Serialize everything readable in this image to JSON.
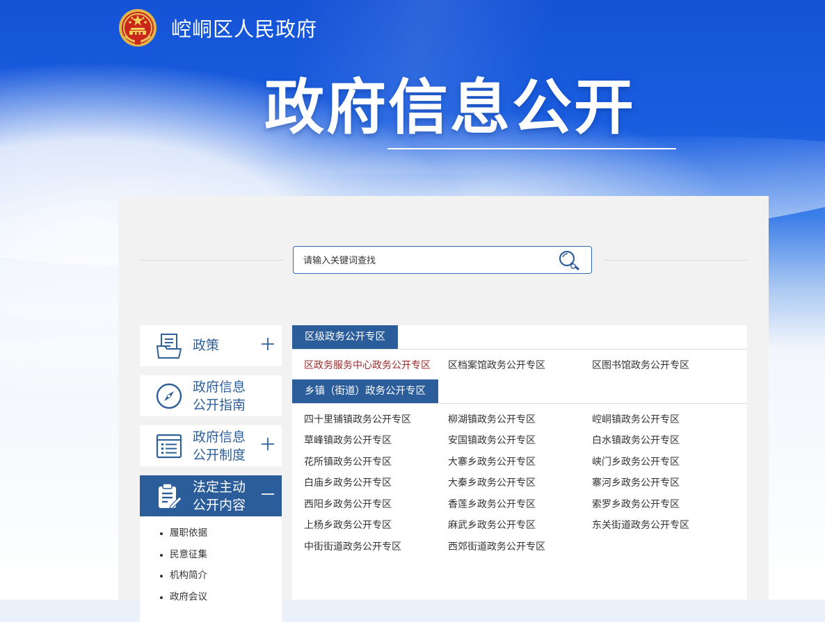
{
  "header": {
    "site_title": "崆峒区人民政府",
    "main_title": "政府信息公开",
    "emblem_icon": "national-emblem-icon"
  },
  "search": {
    "placeholder": "请输入关键词查找",
    "icon": "search-icon"
  },
  "sidebar": {
    "items": [
      {
        "label": "政策",
        "icon": "document-icon",
        "toggle": "plus"
      },
      {
        "label": "政府信息\n公开指南",
        "icon": "compass-icon",
        "toggle": "none"
      },
      {
        "label": "政府信息\n公开制度",
        "icon": "list-icon",
        "toggle": "plus"
      },
      {
        "label": "法定主动\n公开内容",
        "icon": "clipboard-edit-icon",
        "toggle": "minus",
        "active": true
      }
    ],
    "sub_items": [
      "履职依据",
      "民意征集",
      "机构简介",
      "政府会议"
    ]
  },
  "sections": [
    {
      "title": "区级政务公开专区",
      "links": [
        "区政务服务中心政务公开专区",
        "区档案馆政务公开专区",
        "区图书馆政务公开专区"
      ]
    },
    {
      "title": "乡镇（街道）政务公开专区",
      "links": [
        "四十里铺镇政务公开专区",
        "柳湖镇政务公开专区",
        "崆峒镇政务公开专区",
        "草峰镇政务公开专区",
        "安国镇政务公开专区",
        "白水镇政务公开专区",
        "花所镇政务公开专区",
        "大寨乡政务公开专区",
        "峡门乡政务公开专区",
        "白庙乡政务公开专区",
        "大秦乡政务公开专区",
        "寨河乡政务公开专区",
        "西阳乡政务公开专区",
        "香莲乡政务公开专区",
        "索罗乡政务公开专区",
        "上杨乡政务公开专区",
        "麻武乡政务公开专区",
        "东关街道政务公开专区",
        "中街街道政务公开专区",
        "西郊街道政务公开专区"
      ]
    }
  ],
  "colors": {
    "primary": "#2b5d9b",
    "link_highlight": "#9a2a2a",
    "hero_blue": "#1553d6"
  }
}
